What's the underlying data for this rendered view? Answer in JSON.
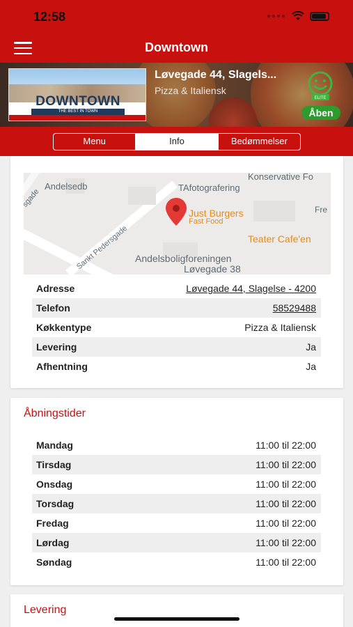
{
  "status_bar": {
    "time": "12:58"
  },
  "nav": {
    "title": "Downtown",
    "menu_icon": "hamburger-icon"
  },
  "banner": {
    "logo_text": "DOWNTOWN",
    "logo_tagline": "THE BEST IN TOWN",
    "address": "Løvegade 44, Slagels...",
    "cuisine": "Pizza & Italiensk",
    "smiley_label": "ELITE",
    "open_label": "Åben"
  },
  "tabs": [
    {
      "label": "Menu"
    },
    {
      "label": "Info"
    },
    {
      "label": "Bedømmelser"
    }
  ],
  "map": {
    "labels": {
      "konservative": "Konservative Fo",
      "andelsdb": "Andelsedb",
      "tafoto": "TAfotografering",
      "sade": "sgade",
      "just_burgers": "Just Burgers",
      "fast_food": "Fast Food",
      "fre": "Fre",
      "teater": "Teater Cafe'en",
      "sankt": "Sankt Pedersgade",
      "andelsbolig": "Andelsboligforeningen",
      "lovegade38": "Løvegade 38"
    }
  },
  "info": {
    "rows": [
      {
        "key": "Adresse",
        "value": "Løvegade 44, Slagelse - 4200"
      },
      {
        "key": "Telefon",
        "value": "58529488"
      },
      {
        "key": "Køkkentype",
        "value": "Pizza & Italiensk"
      },
      {
        "key": "Levering",
        "value": "Ja"
      },
      {
        "key": "Afhentning",
        "value": "Ja"
      }
    ]
  },
  "hours": {
    "title": "Åbningstider",
    "rows": [
      {
        "day": "Mandag",
        "time": "11:00 til 22:00"
      },
      {
        "day": "Tirsdag",
        "time": "11:00 til 22:00"
      },
      {
        "day": "Onsdag",
        "time": "11:00 til 22:00"
      },
      {
        "day": "Torsdag",
        "time": "11:00 til 22:00"
      },
      {
        "day": "Fredag",
        "time": "11:00 til 22:00"
      },
      {
        "day": "Lørdag",
        "time": "11:00 til 22:00"
      },
      {
        "day": "Søndag",
        "time": "11:00 til 22:00"
      }
    ]
  },
  "delivery": {
    "title": "Levering"
  },
  "colors": {
    "brand_red": "#c8100e",
    "open_green": "#2e9b2f",
    "link_text": "#222222"
  }
}
